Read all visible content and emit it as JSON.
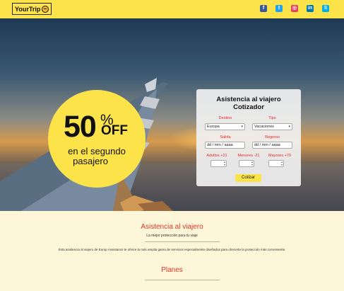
{
  "header": {
    "logo_text": "YourTrip",
    "socials": [
      {
        "name": "facebook-icon",
        "glyph": "f",
        "color": "#3b5998"
      },
      {
        "name": "twitter-icon",
        "glyph": "t",
        "color": "#1da1f2"
      },
      {
        "name": "instagram-icon",
        "glyph": "◎",
        "color": "#e4405f"
      },
      {
        "name": "linkedin-icon",
        "glyph": "in",
        "color": "#0077b5"
      },
      {
        "name": "skype-icon",
        "glyph": "S",
        "color": "#00aff0"
      }
    ]
  },
  "promo": {
    "number": "50",
    "percent": "%",
    "off": "OFF",
    "line1": "en el segundo",
    "line2": "pasajero"
  },
  "form": {
    "title_line1": "Asistencia al viajero",
    "title_line2": "Cotizador",
    "destino_label": "Destino",
    "destino_value": "Europa",
    "tipo_label": "Tipo",
    "tipo_value": "Vacaciones",
    "salida_label": "Salida",
    "salida_value": "dd / mm / aaaa",
    "regreso_label": "Regreso",
    "regreso_value": "dd / mm / aaaa",
    "adultos_label": "Adultos +21",
    "menores_label": "Menores -21",
    "mayores_label": "Mayores +70",
    "submit_label": "Cotizar"
  },
  "content": {
    "section1_title": "Asistencia al viajero",
    "section1_subtitle": "La mejor protección para tu viaje",
    "section1_text": "Esta asistencia al viajero de Europ Assistance te ofrece la más amplia gama de servicios especialmente diseñados para ofrecerte la protección más conveniente.",
    "section2_title": "Planes"
  },
  "colors": {
    "brand_yellow": "#fde34a",
    "accent_red": "#e0342a",
    "page_bg": "#fdf6d8"
  }
}
